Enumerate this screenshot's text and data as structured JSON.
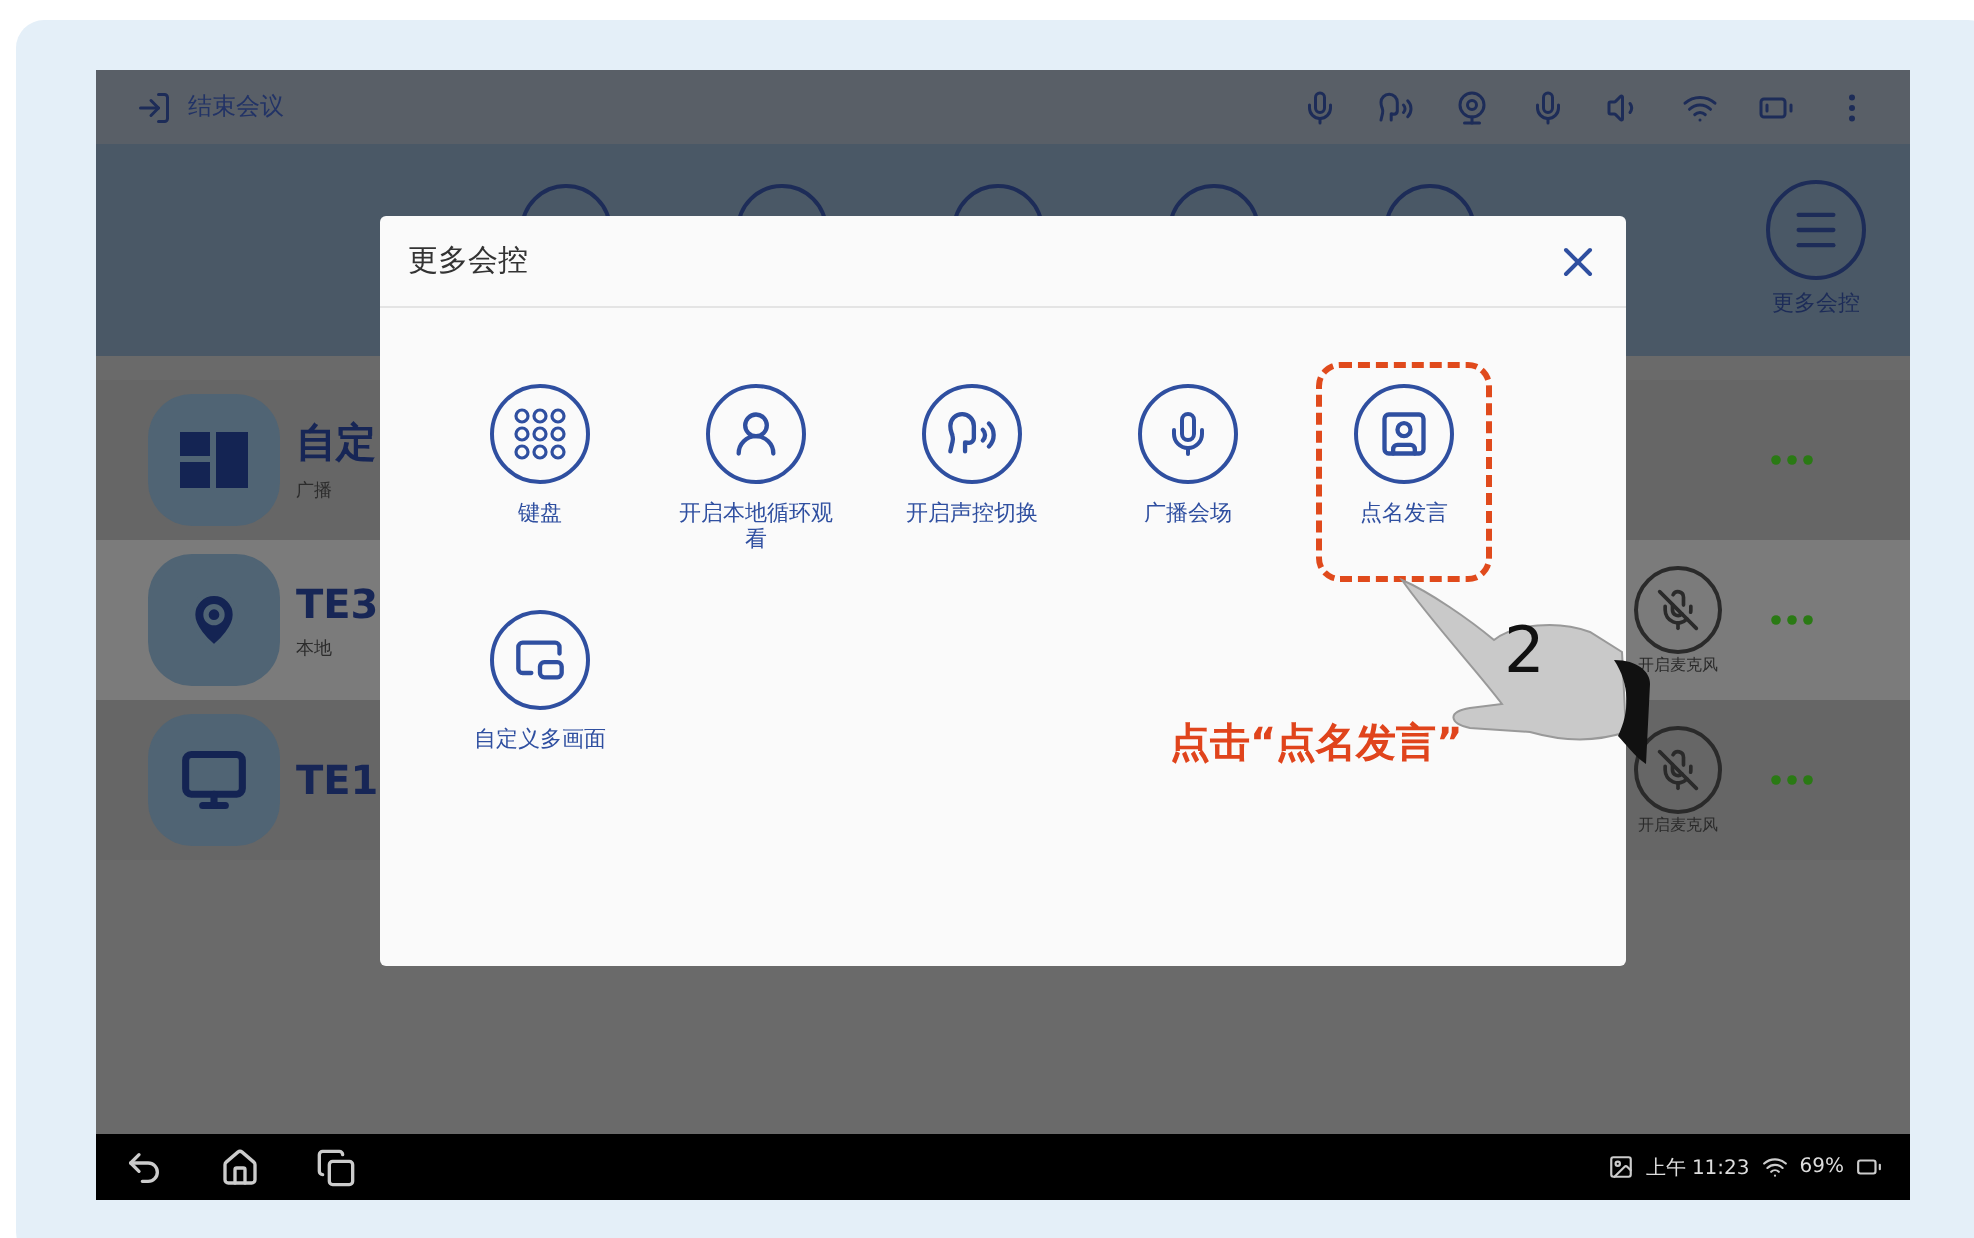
{
  "top_bar": {
    "end_label": "结束会议"
  },
  "toolbar": {
    "buttons": [
      {
        "kind": "plain"
      },
      {
        "kind": "plain"
      },
      {
        "kind": "plain"
      },
      {
        "kind": "plain"
      },
      {
        "kind": "plain"
      },
      {
        "kind": "more",
        "label": "更多会控"
      }
    ]
  },
  "participants": [
    {
      "kind": "layout",
      "name": "自定",
      "status": "广播",
      "selected": false
    },
    {
      "kind": "location",
      "name": "TE3",
      "status": "本地",
      "selected": true,
      "mic_label": "开启麦克风"
    },
    {
      "kind": "screen",
      "name": "TE1",
      "selected": false,
      "mic_label": "开启麦克风"
    }
  ],
  "dialog": {
    "title": "更多会控",
    "items": [
      {
        "kind": "keypad",
        "label": "键盘",
        "selected": false
      },
      {
        "kind": "loop",
        "label": "开启本地循环观看",
        "selected": false
      },
      {
        "kind": "voice",
        "label": "开启声控切换",
        "selected": false
      },
      {
        "kind": "broadcast",
        "label": "广播会场",
        "selected": false
      },
      {
        "kind": "rollcall",
        "label": "点名发言",
        "selected": true
      },
      {
        "kind": "layout",
        "label": "自定义多画面",
        "selected": false
      }
    ]
  },
  "annotation": {
    "step": "2",
    "caption": "点击“点名发言”"
  },
  "status_bar": {
    "time": "上午 11:23",
    "battery": "69%"
  }
}
